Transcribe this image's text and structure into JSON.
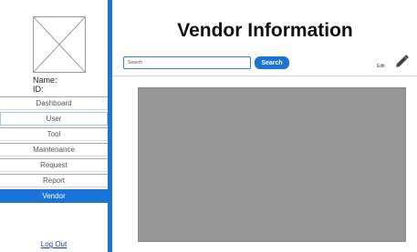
{
  "sidebar": {
    "profile": {
      "name_label": "Name:",
      "id_label": "ID:"
    },
    "items": [
      {
        "label": "Dashboard"
      },
      {
        "label": "User"
      },
      {
        "label": "Tool"
      },
      {
        "label": "Maintenance"
      },
      {
        "label": "Request"
      },
      {
        "label": "Report"
      },
      {
        "label": "Vendor",
        "active": true
      }
    ],
    "logout_label": "Log Out"
  },
  "header": {
    "title": "Vendor Information",
    "search": {
      "placeholder": "Search",
      "button_label": "Search"
    },
    "edit_label": "Edit"
  },
  "colors": {
    "accent": "#1a73d9",
    "content_placeholder": "#979797"
  },
  "icons": {
    "avatar": "image-placeholder-icon",
    "edit": "pencil-icon"
  }
}
